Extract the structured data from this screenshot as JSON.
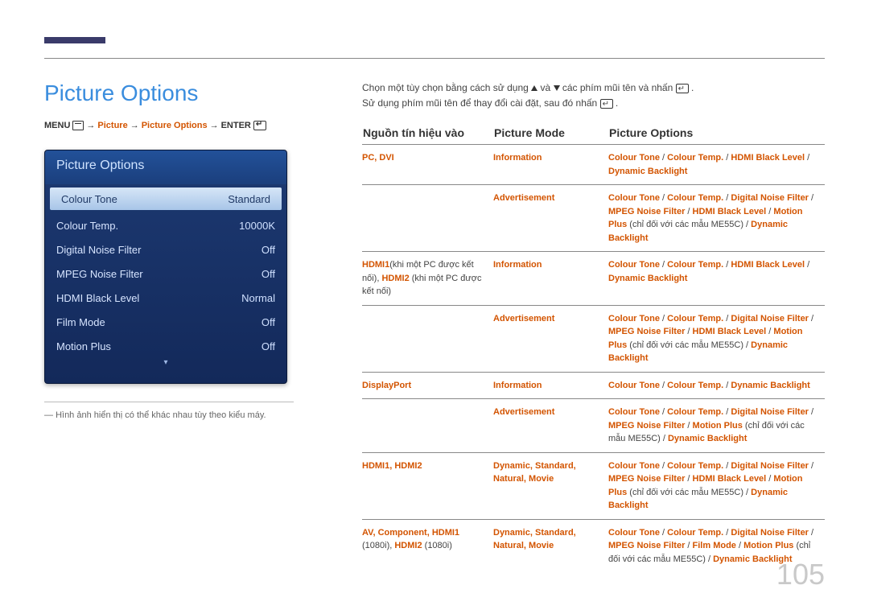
{
  "page_title": "Picture Options",
  "breadcrumb": {
    "menu": "MENU",
    "arrow": "→",
    "picture": "Picture",
    "picture_options": "Picture Options",
    "enter": "ENTER"
  },
  "osd": {
    "title": "Picture Options",
    "rows": [
      {
        "label": "Colour Tone",
        "value": "Standard",
        "selected": true
      },
      {
        "label": "Colour Temp.",
        "value": "10000K",
        "selected": false
      },
      {
        "label": "Digital Noise Filter",
        "value": "Off",
        "selected": false
      },
      {
        "label": "MPEG Noise Filter",
        "value": "Off",
        "selected": false
      },
      {
        "label": "HDMI Black Level",
        "value": "Normal",
        "selected": false
      },
      {
        "label": "Film Mode",
        "value": "Off",
        "selected": false
      },
      {
        "label": "Motion Plus",
        "value": "Off",
        "selected": false
      }
    ]
  },
  "footnote": "Hình ảnh hiển thị có thể khác nhau tùy theo kiểu máy.",
  "intro_line1_a": "Chọn một tùy chọn bằng cách sử dụng ",
  "intro_line1_b": " và ",
  "intro_line1_c": " các phím mũi tên và nhấn ",
  "intro_line1_d": ".",
  "intro_line2_a": "Sử dụng phím mũi tên để thay đổi cài đặt, sau đó nhấn ",
  "intro_line2_b": ".",
  "table": {
    "headers": {
      "h1": "Nguồn tín hiệu vào",
      "h2": "Picture Mode",
      "h3": "Picture Options"
    },
    "rows": [
      {
        "src_parts": [
          {
            "t": "PC",
            "c": "red"
          },
          {
            "t": ", ",
            "c": "red"
          },
          {
            "t": "DVI",
            "c": "red"
          }
        ],
        "mode_parts": [
          {
            "t": "Information",
            "c": "red"
          }
        ],
        "opt_parts": [
          {
            "t": "Colour Tone",
            "c": "red"
          },
          {
            "t": " / ",
            "c": "blk"
          },
          {
            "t": "Colour Temp.",
            "c": "red"
          },
          {
            "t": " / ",
            "c": "blk"
          },
          {
            "t": "HDMI Black Level",
            "c": "red"
          },
          {
            "t": " / ",
            "c": "blk"
          },
          {
            "t": "Dynamic Backlight",
            "c": "red"
          }
        ],
        "sep": true
      },
      {
        "src_parts": [],
        "mode_parts": [
          {
            "t": "Advertisement",
            "c": "red"
          }
        ],
        "opt_parts": [
          {
            "t": "Colour Tone",
            "c": "red"
          },
          {
            "t": " / ",
            "c": "blk"
          },
          {
            "t": "Colour Temp.",
            "c": "red"
          },
          {
            "t": " / ",
            "c": "blk"
          },
          {
            "t": "Digital Noise Filter",
            "c": "red"
          },
          {
            "t": " / ",
            "c": "blk"
          },
          {
            "t": "MPEG Noise Filter",
            "c": "red"
          },
          {
            "t": " / ",
            "c": "blk"
          },
          {
            "t": "HDMI Black Level",
            "c": "red"
          },
          {
            "t": " / ",
            "c": "blk"
          },
          {
            "t": "Motion Plus",
            "c": "red"
          },
          {
            "t": " (chỉ đối với các mẫu ME55C) / ",
            "c": "blk"
          },
          {
            "t": "Dynamic Backlight",
            "c": "red"
          }
        ],
        "sep": true
      },
      {
        "src_parts": [
          {
            "t": "HDMI1",
            "c": "red"
          },
          {
            "t": "(khi một PC được kết nối), ",
            "c": "blk"
          },
          {
            "t": "HDMI2",
            "c": "red"
          },
          {
            "t": " (khi một PC được kết nối)",
            "c": "blk"
          }
        ],
        "mode_parts": [
          {
            "t": "Information",
            "c": "red"
          }
        ],
        "opt_parts": [
          {
            "t": "Colour Tone",
            "c": "red"
          },
          {
            "t": " / ",
            "c": "blk"
          },
          {
            "t": "Colour Temp.",
            "c": "red"
          },
          {
            "t": " / ",
            "c": "blk"
          },
          {
            "t": "HDMI Black Level",
            "c": "red"
          },
          {
            "t": " / ",
            "c": "blk"
          },
          {
            "t": "Dynamic Backlight",
            "c": "red"
          }
        ],
        "sep": true
      },
      {
        "src_parts": [],
        "mode_parts": [
          {
            "t": "Advertisement",
            "c": "red"
          }
        ],
        "opt_parts": [
          {
            "t": "Colour Tone",
            "c": "red"
          },
          {
            "t": " / ",
            "c": "blk"
          },
          {
            "t": "Colour Temp.",
            "c": "red"
          },
          {
            "t": " / ",
            "c": "blk"
          },
          {
            "t": "Digital Noise Filter",
            "c": "red"
          },
          {
            "t": " / ",
            "c": "blk"
          },
          {
            "t": "MPEG Noise Filter",
            "c": "red"
          },
          {
            "t": " / ",
            "c": "blk"
          },
          {
            "t": "HDMI Black Level",
            "c": "red"
          },
          {
            "t": " / ",
            "c": "blk"
          },
          {
            "t": "Motion Plus",
            "c": "red"
          },
          {
            "t": " (chỉ đối với các mẫu ME55C) / ",
            "c": "blk"
          },
          {
            "t": "Dynamic Backlight",
            "c": "red"
          }
        ],
        "sep": true
      },
      {
        "src_parts": [
          {
            "t": "DisplayPort",
            "c": "red"
          }
        ],
        "mode_parts": [
          {
            "t": "Information",
            "c": "red"
          }
        ],
        "opt_parts": [
          {
            "t": "Colour Tone",
            "c": "red"
          },
          {
            "t": " / ",
            "c": "blk"
          },
          {
            "t": "Colour Temp.",
            "c": "red"
          },
          {
            "t": " / ",
            "c": "blk"
          },
          {
            "t": "Dynamic Backlight",
            "c": "red"
          }
        ],
        "sep": true
      },
      {
        "src_parts": [],
        "mode_parts": [
          {
            "t": "Advertisement",
            "c": "red"
          }
        ],
        "opt_parts": [
          {
            "t": "Colour Tone",
            "c": "red"
          },
          {
            "t": " / ",
            "c": "blk"
          },
          {
            "t": "Colour Temp.",
            "c": "red"
          },
          {
            "t": " / ",
            "c": "blk"
          },
          {
            "t": "Digital Noise Filter",
            "c": "red"
          },
          {
            "t": " / ",
            "c": "blk"
          },
          {
            "t": "MPEG Noise Filter",
            "c": "red"
          },
          {
            "t": " / ",
            "c": "blk"
          },
          {
            "t": "Motion Plus",
            "c": "red"
          },
          {
            "t": " (chỉ đối với các mẫu ME55C) / ",
            "c": "blk"
          },
          {
            "t": "Dynamic Backlight",
            "c": "red"
          }
        ],
        "sep": true
      },
      {
        "src_parts": [
          {
            "t": "HDMI1",
            "c": "red"
          },
          {
            "t": ", ",
            "c": "red"
          },
          {
            "t": "HDMI2",
            "c": "red"
          }
        ],
        "mode_parts": [
          {
            "t": "Dynamic",
            "c": "red"
          },
          {
            "t": ", ",
            "c": "red"
          },
          {
            "t": "Standard",
            "c": "red"
          },
          {
            "t": ", ",
            "c": "red"
          },
          {
            "t": "Natural",
            "c": "red"
          },
          {
            "t": ", ",
            "c": "red"
          },
          {
            "t": "Movie",
            "c": "red"
          }
        ],
        "opt_parts": [
          {
            "t": "Colour Tone",
            "c": "red"
          },
          {
            "t": " / ",
            "c": "blk"
          },
          {
            "t": "Colour Temp.",
            "c": "red"
          },
          {
            "t": " / ",
            "c": "blk"
          },
          {
            "t": "Digital Noise Filter",
            "c": "red"
          },
          {
            "t": " / ",
            "c": "blk"
          },
          {
            "t": "MPEG Noise Filter",
            "c": "red"
          },
          {
            "t": " / ",
            "c": "blk"
          },
          {
            "t": "HDMI Black Level",
            "c": "red"
          },
          {
            "t": " / ",
            "c": "blk"
          },
          {
            "t": "Motion Plus",
            "c": "red"
          },
          {
            "t": " (chỉ đối với các mẫu ME55C) / ",
            "c": "blk"
          },
          {
            "t": "Dynamic Backlight",
            "c": "red"
          }
        ],
        "sep": true
      },
      {
        "src_parts": [
          {
            "t": "AV",
            "c": "red"
          },
          {
            "t": ", ",
            "c": "red"
          },
          {
            "t": "Component",
            "c": "red"
          },
          {
            "t": ", ",
            "c": "red"
          },
          {
            "t": "HDMI1",
            "c": "red"
          },
          {
            "t": " (1080i), ",
            "c": "blk"
          },
          {
            "t": "HDMI2",
            "c": "red"
          },
          {
            "t": " (1080i)",
            "c": "blk"
          }
        ],
        "mode_parts": [
          {
            "t": "Dynamic",
            "c": "red"
          },
          {
            "t": ", ",
            "c": "red"
          },
          {
            "t": "Standard",
            "c": "red"
          },
          {
            "t": ", ",
            "c": "red"
          },
          {
            "t": "Natural",
            "c": "red"
          },
          {
            "t": ", ",
            "c": "red"
          },
          {
            "t": "Movie",
            "c": "red"
          }
        ],
        "opt_parts": [
          {
            "t": "Colour Tone",
            "c": "red"
          },
          {
            "t": " / ",
            "c": "blk"
          },
          {
            "t": "Colour Temp.",
            "c": "red"
          },
          {
            "t": " / ",
            "c": "blk"
          },
          {
            "t": "Digital Noise Filter",
            "c": "red"
          },
          {
            "t": " / ",
            "c": "blk"
          },
          {
            "t": "MPEG Noise Filter",
            "c": "red"
          },
          {
            "t": " / ",
            "c": "blk"
          },
          {
            "t": "Film Mode",
            "c": "red"
          },
          {
            "t": " / ",
            "c": "blk"
          },
          {
            "t": "Motion Plus",
            "c": "red"
          },
          {
            "t": " (chỉ đối với các mẫu ME55C) / ",
            "c": "blk"
          },
          {
            "t": "Dynamic Backlight",
            "c": "red"
          }
        ],
        "sep": true
      }
    ]
  },
  "page_number": "105",
  "dash": "― "
}
